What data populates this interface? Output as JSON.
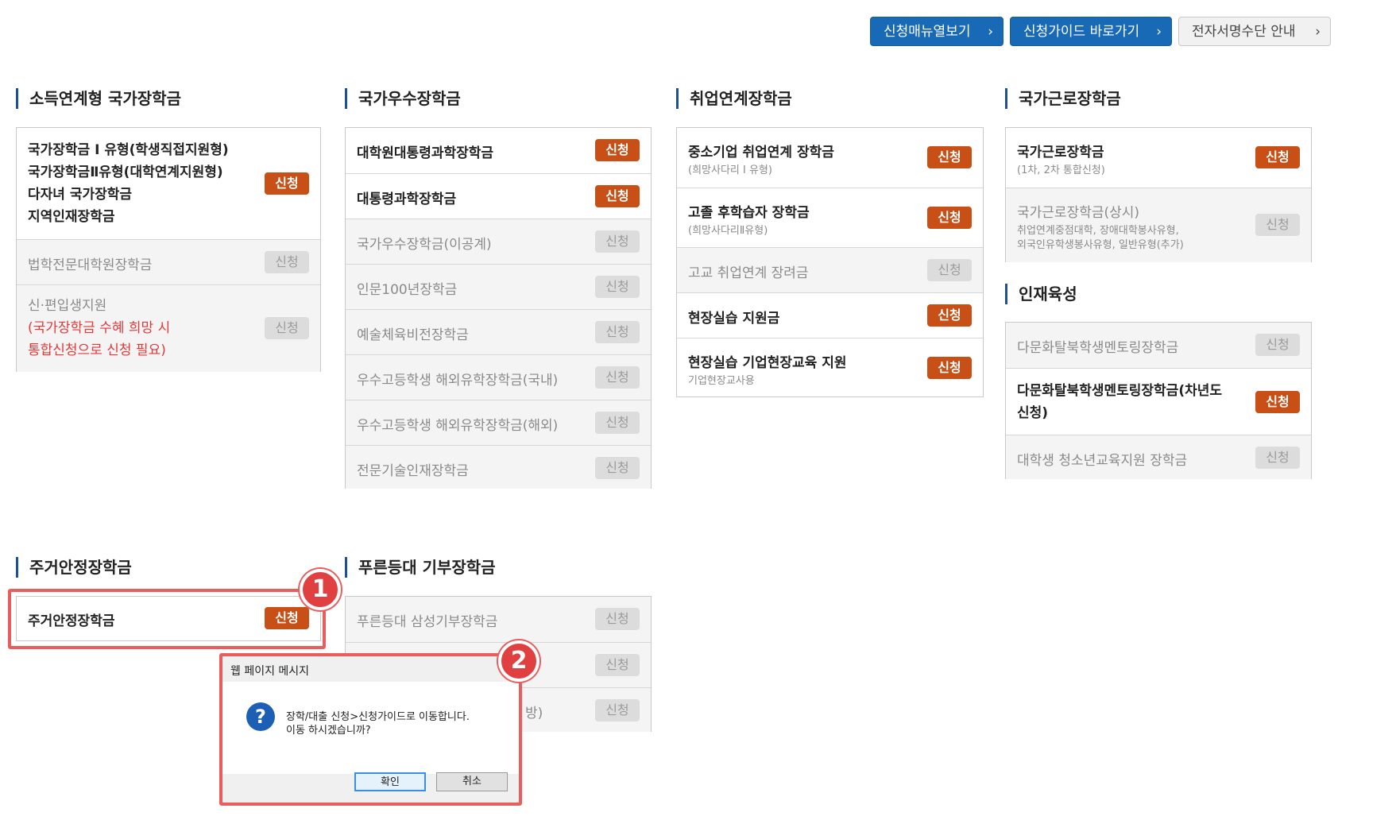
{
  "top_buttons": {
    "menu": "신청매뉴열보기",
    "guide": "신청가이드 바로가기",
    "esign": "전자서명수단 안내",
    "chevron": "›"
  },
  "apply_label": "신청",
  "sections": {
    "income": {
      "title": "소득연계형 국가장학금",
      "items": [
        {
          "lines": [
            "국가장학금 I 유형(학생직접지원형)",
            "국가장학금Ⅱ유형(대학연계지원형)",
            "다자녀 국가장학금",
            "지역인재장학금"
          ]
        },
        {
          "label": "법학전문대학원장학금"
        },
        {
          "line1": "신·편입생지원",
          "line2": "(국가장학금 수혜 희망 시",
          "line3": "통합신청으로 신청 필요)"
        }
      ]
    },
    "merit": {
      "title": "국가우수장학금",
      "items": [
        "대학원대통령과학장학금",
        "대통령과학장학금",
        "국가우수장학금(이공계)",
        "인문100년장학금",
        "예술체육비전장학금",
        "우수고등학생 해외유학장학금(국내)",
        "우수고등학생 해외유학장학금(해외)",
        "전문기술인재장학금"
      ]
    },
    "employment": {
      "title": "취업연계장학금",
      "items": [
        {
          "label": "중소기업 취업연계 장학금",
          "sub": "(희망사다리 I 유형)"
        },
        {
          "label": "고졸 후학습자 장학금",
          "sub": "(희망사다리Ⅱ유형)"
        },
        {
          "label": "고교 취업연계 장려금"
        },
        {
          "label": "현장실습 지원금"
        },
        {
          "label": "현장실습 기업현장교육 지원",
          "sub": "기업현장교사용"
        }
      ]
    },
    "work": {
      "title": "국가근로장학금",
      "items": [
        {
          "label": "국가근로장학금",
          "sub": "(1차, 2차 통합신청)"
        },
        {
          "label": "국가근로장학금(상시)",
          "sub1": "취업연계중점대학, 장애대학봉사유형,",
          "sub2": "외국인유학생봉사유형, 일반유형(추가)"
        }
      ]
    },
    "talent": {
      "title": "인재육성",
      "items": [
        {
          "label": "다문화탈북학생멘토링장학금"
        },
        {
          "line1": "다문화탈북학생멘토링장학금(차년도",
          "line2": "신청)"
        },
        {
          "label": "대학생 청소년교육지원 장학금"
        }
      ]
    },
    "housing": {
      "title": "주거안정장학금",
      "items": [
        "주거안정장학금"
      ]
    },
    "donation": {
      "title": "푸른등대 기부장학금",
      "items": [
        "푸른등대 삼성기부장학금",
        "",
        "방)"
      ]
    }
  },
  "annotations": {
    "step1": "1",
    "step2": "2"
  },
  "dialog": {
    "title": "웹 페이지 메시지",
    "message_line1": "장학/대출 신청>신청가이드로 이동합니다.",
    "message_line2": "이동 하시겠습니까?",
    "ok": "확인",
    "cancel": "취소",
    "icon": "?"
  }
}
